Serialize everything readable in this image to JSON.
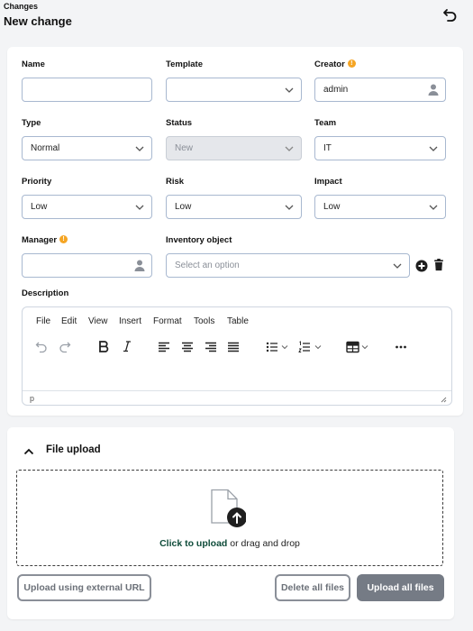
{
  "header": {
    "breadcrumb": "Changes",
    "title": "New change"
  },
  "fields": {
    "name": {
      "label": "Name",
      "value": ""
    },
    "template": {
      "label": "Template",
      "value": ""
    },
    "creator": {
      "label": "Creator",
      "value": "admin",
      "info": "!"
    },
    "type": {
      "label": "Type",
      "value": "Normal"
    },
    "status": {
      "label": "Status",
      "value": "New"
    },
    "team": {
      "label": "Team",
      "value": "IT"
    },
    "priority": {
      "label": "Priority",
      "value": "Low"
    },
    "risk": {
      "label": "Risk",
      "value": "Low"
    },
    "impact": {
      "label": "Impact",
      "value": "Low"
    },
    "manager": {
      "label": "Manager",
      "value": "",
      "info": "!"
    },
    "inventory": {
      "label": "Inventory object",
      "placeholder": "Select an option"
    },
    "description": {
      "label": "Description"
    }
  },
  "editor": {
    "menus": [
      "File",
      "Edit",
      "View",
      "Insert",
      "Format",
      "Tools",
      "Table"
    ],
    "status_path": "p"
  },
  "upload": {
    "title": "File upload",
    "click_text": "Click to upload",
    "drag_text": " or drag and drop",
    "btn_external": "Upload using external URL",
    "btn_delete": "Delete all files",
    "btn_upload": "Upload all files"
  },
  "colors": {
    "accent_link": "#0f4c3a",
    "info": "#f5a524",
    "field_border": "#a8b8d0"
  }
}
